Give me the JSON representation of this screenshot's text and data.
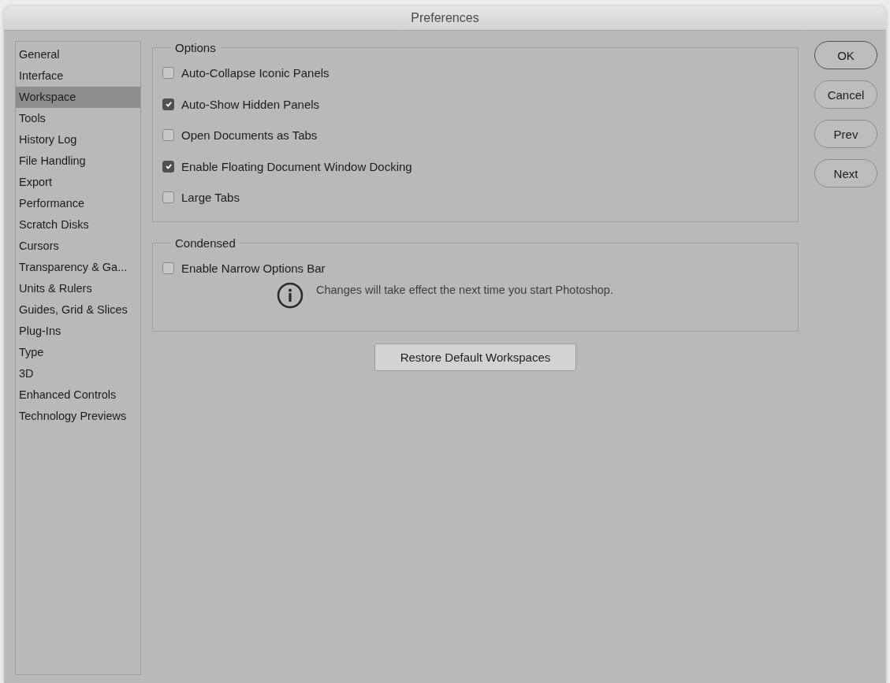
{
  "window": {
    "title": "Preferences"
  },
  "sidebar": {
    "items": [
      {
        "label": "General",
        "selected": false
      },
      {
        "label": "Interface",
        "selected": false
      },
      {
        "label": "Workspace",
        "selected": true
      },
      {
        "label": "Tools",
        "selected": false
      },
      {
        "label": "History Log",
        "selected": false
      },
      {
        "label": "File Handling",
        "selected": false
      },
      {
        "label": "Export",
        "selected": false
      },
      {
        "label": "Performance",
        "selected": false
      },
      {
        "label": "Scratch Disks",
        "selected": false
      },
      {
        "label": "Cursors",
        "selected": false
      },
      {
        "label": "Transparency & Ga...",
        "selected": false
      },
      {
        "label": "Units & Rulers",
        "selected": false
      },
      {
        "label": "Guides, Grid & Slices",
        "selected": false
      },
      {
        "label": "Plug-Ins",
        "selected": false
      },
      {
        "label": "Type",
        "selected": false
      },
      {
        "label": "3D",
        "selected": false
      },
      {
        "label": "Enhanced Controls",
        "selected": false
      },
      {
        "label": "Technology Previews",
        "selected": false
      }
    ]
  },
  "groups": [
    {
      "title": "Options",
      "checkboxes": [
        {
          "label": "Auto-Collapse Iconic Panels",
          "checked": false
        },
        {
          "label": "Auto-Show Hidden Panels",
          "checked": true
        },
        {
          "label": "Open Documents as Tabs",
          "checked": false
        },
        {
          "label": "Enable Floating Document Window Docking",
          "checked": true
        },
        {
          "label": "Large Tabs",
          "checked": false
        }
      ]
    },
    {
      "title": "Condensed",
      "checkboxes": [
        {
          "label": "Enable Narrow Options Bar",
          "checked": false
        }
      ],
      "note": "Changes will take effect the next time you start Photoshop."
    }
  ],
  "restore_button": "Restore Default Workspaces",
  "buttons": [
    {
      "label": "OK",
      "default": true
    },
    {
      "label": "Cancel",
      "default": false
    },
    {
      "label": "Prev",
      "default": false
    },
    {
      "label": "Next",
      "default": false
    }
  ]
}
